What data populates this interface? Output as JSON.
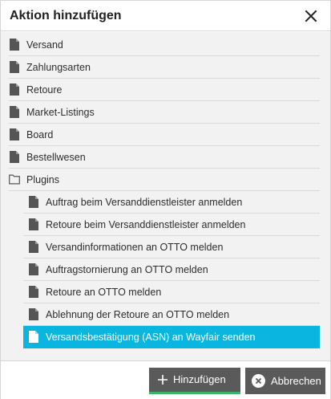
{
  "dialog": {
    "title": "Aktion hinzufügen",
    "close_icon": "close-icon"
  },
  "tree": {
    "items": [
      {
        "label": "Versand",
        "icon": "file-icon"
      },
      {
        "label": "Zahlungsarten",
        "icon": "file-icon"
      },
      {
        "label": "Retoure",
        "icon": "file-icon"
      },
      {
        "label": "Market-Listings",
        "icon": "file-icon"
      },
      {
        "label": "Board",
        "icon": "file-icon"
      },
      {
        "label": "Bestellwesen",
        "icon": "file-icon"
      },
      {
        "label": "Plugins",
        "icon": "folder-open-icon"
      }
    ],
    "children": [
      {
        "label": "Auftrag beim Versanddienstleister anmelden",
        "icon": "file-icon"
      },
      {
        "label": "Retoure beim Versanddienstleister anmelden",
        "icon": "file-icon"
      },
      {
        "label": "Versandinformationen an OTTO melden",
        "icon": "file-icon"
      },
      {
        "label": "Auftragstornierung an OTTO melden",
        "icon": "file-icon"
      },
      {
        "label": "Retoure an OTTO melden",
        "icon": "file-icon"
      },
      {
        "label": "Ablehnung der Retoure an OTTO melden",
        "icon": "file-icon"
      },
      {
        "label": "Versandsbestätigung (ASN) an Wayfair senden",
        "icon": "file-icon",
        "selected": true
      }
    ]
  },
  "footer": {
    "add_label": "Hinzufügen",
    "cancel_label": "Abbrechen"
  },
  "colors": {
    "selected_bg": "#0ab6e0",
    "button_bg": "#5a5a5a",
    "add_accent": "#3cb36a"
  }
}
